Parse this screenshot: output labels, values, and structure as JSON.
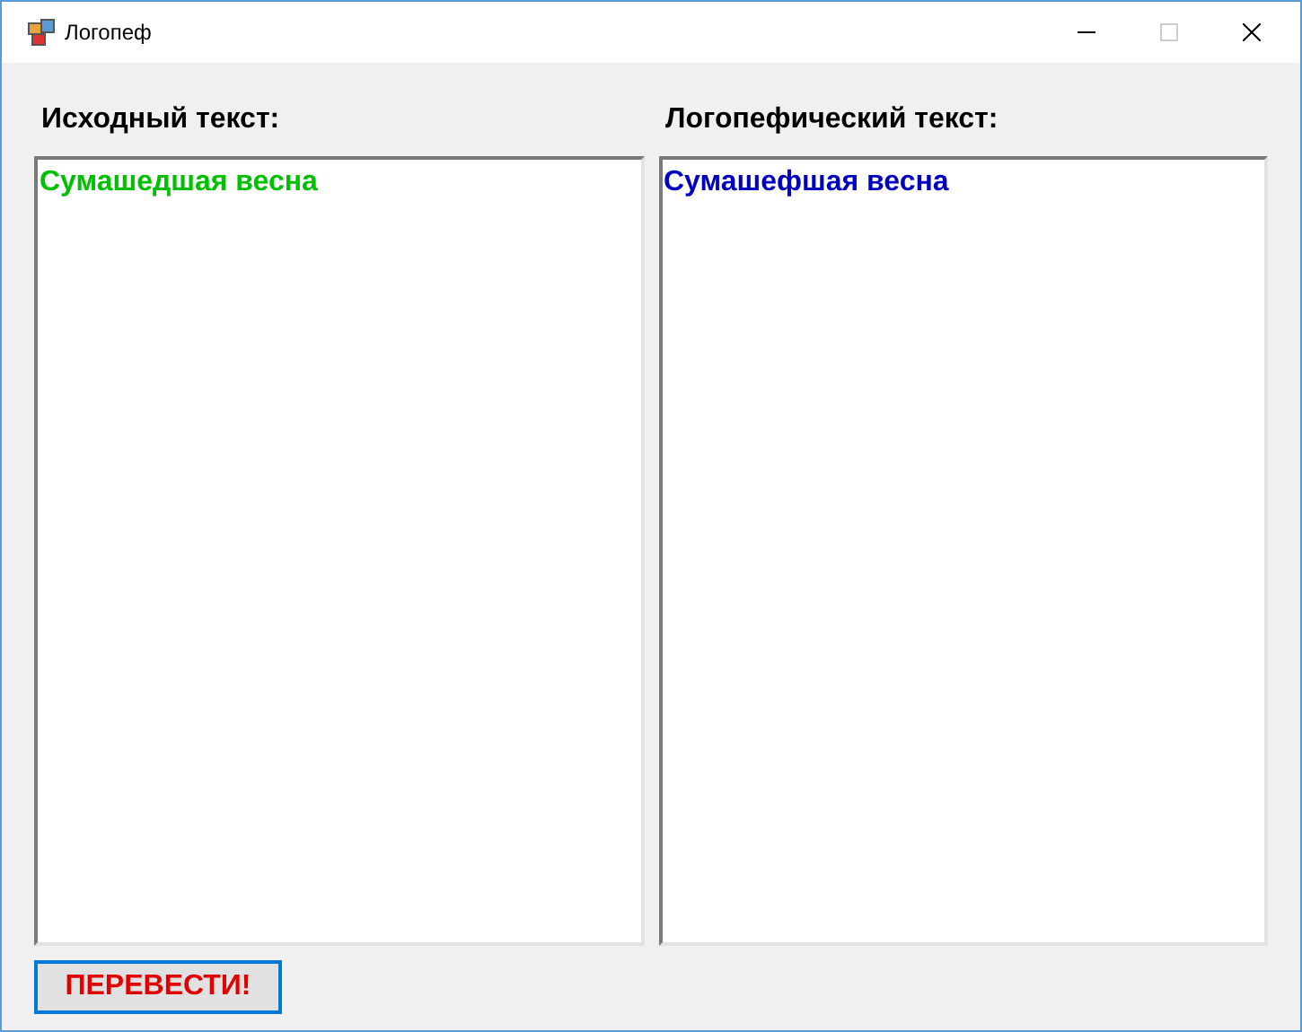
{
  "window": {
    "title": "Логопеф"
  },
  "panes": [
    {
      "label": "Исходный текст:",
      "value": "Сумашедшая весна",
      "color": "#00c000"
    },
    {
      "label": "Логопефический текст:",
      "value": "Сумашефшая весна",
      "color": "#0000c0"
    }
  ],
  "button": {
    "label": "ПЕРЕВЕСТИ!"
  }
}
